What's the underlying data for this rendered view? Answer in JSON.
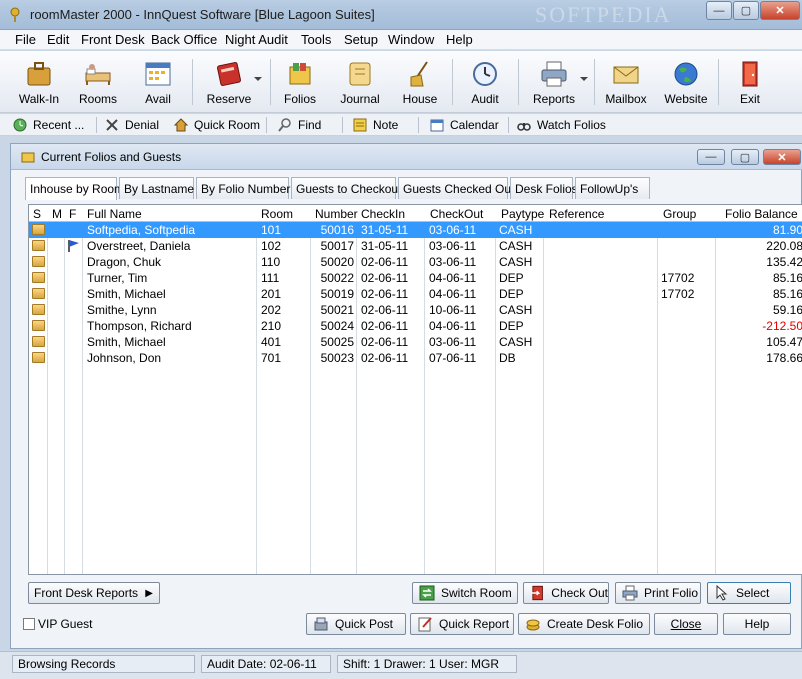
{
  "window": {
    "title": "roomMaster 2000 - InnQuest Software [Blue Lagoon Suites]",
    "watermark": "SOFTPEDIA"
  },
  "menu": [
    "File",
    "Edit",
    "Front Desk",
    "Back Office",
    "Night Audit",
    "Tools",
    "Setup",
    "Window",
    "Help"
  ],
  "toolbar": {
    "buttons": [
      "Walk-In",
      "Rooms",
      "Avail",
      "Reserve",
      "Folios",
      "Journal",
      "House",
      "Audit",
      "Reports",
      "Mailbox",
      "Website",
      "Exit"
    ]
  },
  "quickbar": {
    "buttons": [
      "Recent ...",
      "Denial",
      "Quick Room",
      "Find",
      "Note",
      "Calendar",
      "Watch Folios"
    ]
  },
  "child": {
    "title": "Current Folios and Guests",
    "tabs": [
      "Inhouse by Room",
      "By Lastname",
      "By Folio Number",
      "Guests to Checkout",
      "Guests Checked Out",
      "Desk Folios",
      "FollowUp's"
    ],
    "active_tab": "Inhouse by Room",
    "columns": [
      "S",
      "M",
      "F",
      "Full Name",
      "Room",
      "Number",
      "CheckIn",
      "CheckOut",
      "Paytype",
      "Reference",
      "Group",
      "Folio Balance"
    ],
    "rows": [
      {
        "name": "Softpedia, Softpedia",
        "room": "101",
        "number": "50016",
        "checkin": "31-05-11",
        "checkout": "03-06-11",
        "paytype": "CASH",
        "reference": "",
        "group": "",
        "balance": "81.90"
      },
      {
        "name": "Overstreet, Daniela",
        "room": "102",
        "number": "50017",
        "checkin": "31-05-11",
        "checkout": "03-06-11",
        "paytype": "CASH",
        "reference": "",
        "group": "",
        "balance": "220.08"
      },
      {
        "name": "Dragon, Chuk",
        "room": "110",
        "number": "50020",
        "checkin": "02-06-11",
        "checkout": "03-06-11",
        "paytype": "CASH",
        "reference": "",
        "group": "",
        "balance": "135.42"
      },
      {
        "name": "Turner, Tim",
        "room": "111",
        "number": "50022",
        "checkin": "02-06-11",
        "checkout": "04-06-11",
        "paytype": "DEP",
        "reference": "",
        "group": "17702",
        "balance": "85.16"
      },
      {
        "name": "Smith, Michael",
        "room": "201",
        "number": "50019",
        "checkin": "02-06-11",
        "checkout": "04-06-11",
        "paytype": "DEP",
        "reference": "",
        "group": "17702",
        "balance": "85.16"
      },
      {
        "name": "Smithe, Lynn",
        "room": "202",
        "number": "50021",
        "checkin": "02-06-11",
        "checkout": "10-06-11",
        "paytype": "CASH",
        "reference": "",
        "group": "",
        "balance": "59.16"
      },
      {
        "name": "Thompson, Richard",
        "room": "210",
        "number": "50024",
        "checkin": "02-06-11",
        "checkout": "04-06-11",
        "paytype": "DEP",
        "reference": "",
        "group": "",
        "balance": "-212.50"
      },
      {
        "name": "Smith, Michael",
        "room": "401",
        "number": "50025",
        "checkin": "02-06-11",
        "checkout": "03-06-11",
        "paytype": "CASH",
        "reference": "",
        "group": "",
        "balance": "105.47"
      },
      {
        "name": "Johnson, Don",
        "room": "701",
        "number": "50023",
        "checkin": "02-06-11",
        "checkout": "07-06-11",
        "paytype": "DB",
        "reference": "",
        "group": "",
        "balance": "178.66"
      }
    ],
    "front_desk_reports": "Front Desk Reports",
    "switch_room": "Switch Room",
    "check_out": "Check Out",
    "print_folio": "Print Folio",
    "select": "Select",
    "vip_guest": "VIP Guest",
    "quick_post": "Quick Post",
    "quick_report": "Quick Report",
    "create_desk_folio": "Create Desk Folio",
    "close": "Close",
    "help": "Help"
  },
  "status": {
    "message": "Browsing Records",
    "audit_date": "Audit Date: 02-06-11",
    "shift_drawer_user": "Shift: 1  Drawer: 1  User: MGR"
  },
  "colors": {
    "selection": "#3399ff",
    "negative": "#e00000"
  }
}
